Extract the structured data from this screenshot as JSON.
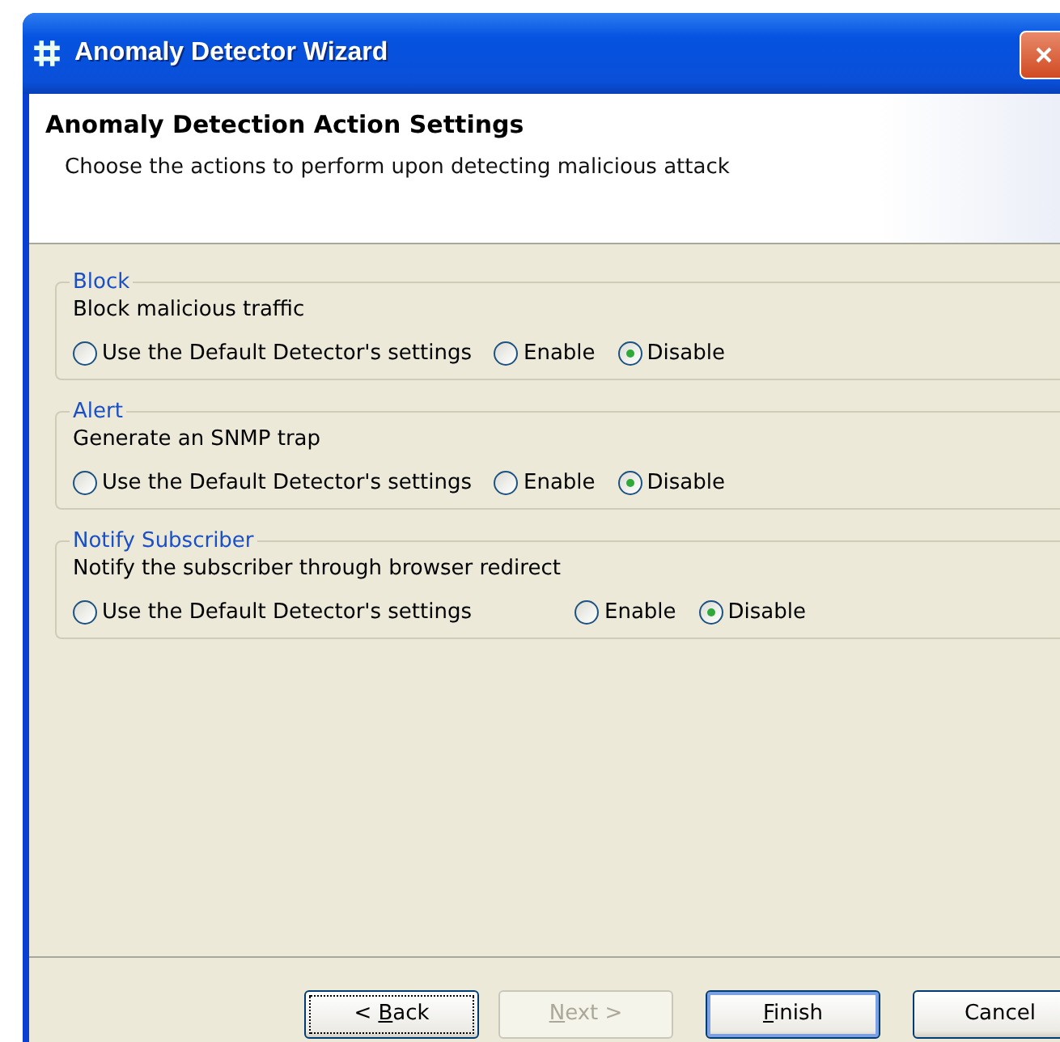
{
  "window": {
    "title": "Anomaly Detector Wizard"
  },
  "header": {
    "title": "Anomaly Detection Action Settings",
    "description": "Choose the actions to perform upon detecting malicious attack"
  },
  "groups": [
    {
      "title": "Block",
      "description": "Block malicious traffic",
      "options": [
        {
          "label": "Use the Default Detector's settings",
          "selected": false
        },
        {
          "label": "Enable",
          "selected": false
        },
        {
          "label": "Disable",
          "selected": true
        }
      ]
    },
    {
      "title": "Alert",
      "description": "Generate an SNMP trap",
      "options": [
        {
          "label": "Use the Default Detector's settings",
          "selected": false
        },
        {
          "label": "Enable",
          "selected": false
        },
        {
          "label": "Disable",
          "selected": true
        }
      ]
    },
    {
      "title": "Notify Subscriber",
      "description": "Notify the subscriber through browser redirect",
      "options": [
        {
          "label": "Use the Default Detector's settings",
          "selected": false
        },
        {
          "label": "Enable",
          "selected": false
        },
        {
          "label": "Disable",
          "selected": true
        }
      ]
    }
  ],
  "buttons": [
    {
      "label_before": "< ",
      "access_key": "B",
      "label_after": "ack",
      "disabled": false,
      "focused": true,
      "default": false
    },
    {
      "access_key": "N",
      "label_after": "ext >",
      "disabled": true,
      "focused": false,
      "default": false
    },
    {
      "access_key": "F",
      "label_after": "inish",
      "disabled": false,
      "focused": false,
      "default": true
    },
    {
      "label_after": "Cancel",
      "disabled": false,
      "focused": false,
      "default": false
    }
  ]
}
